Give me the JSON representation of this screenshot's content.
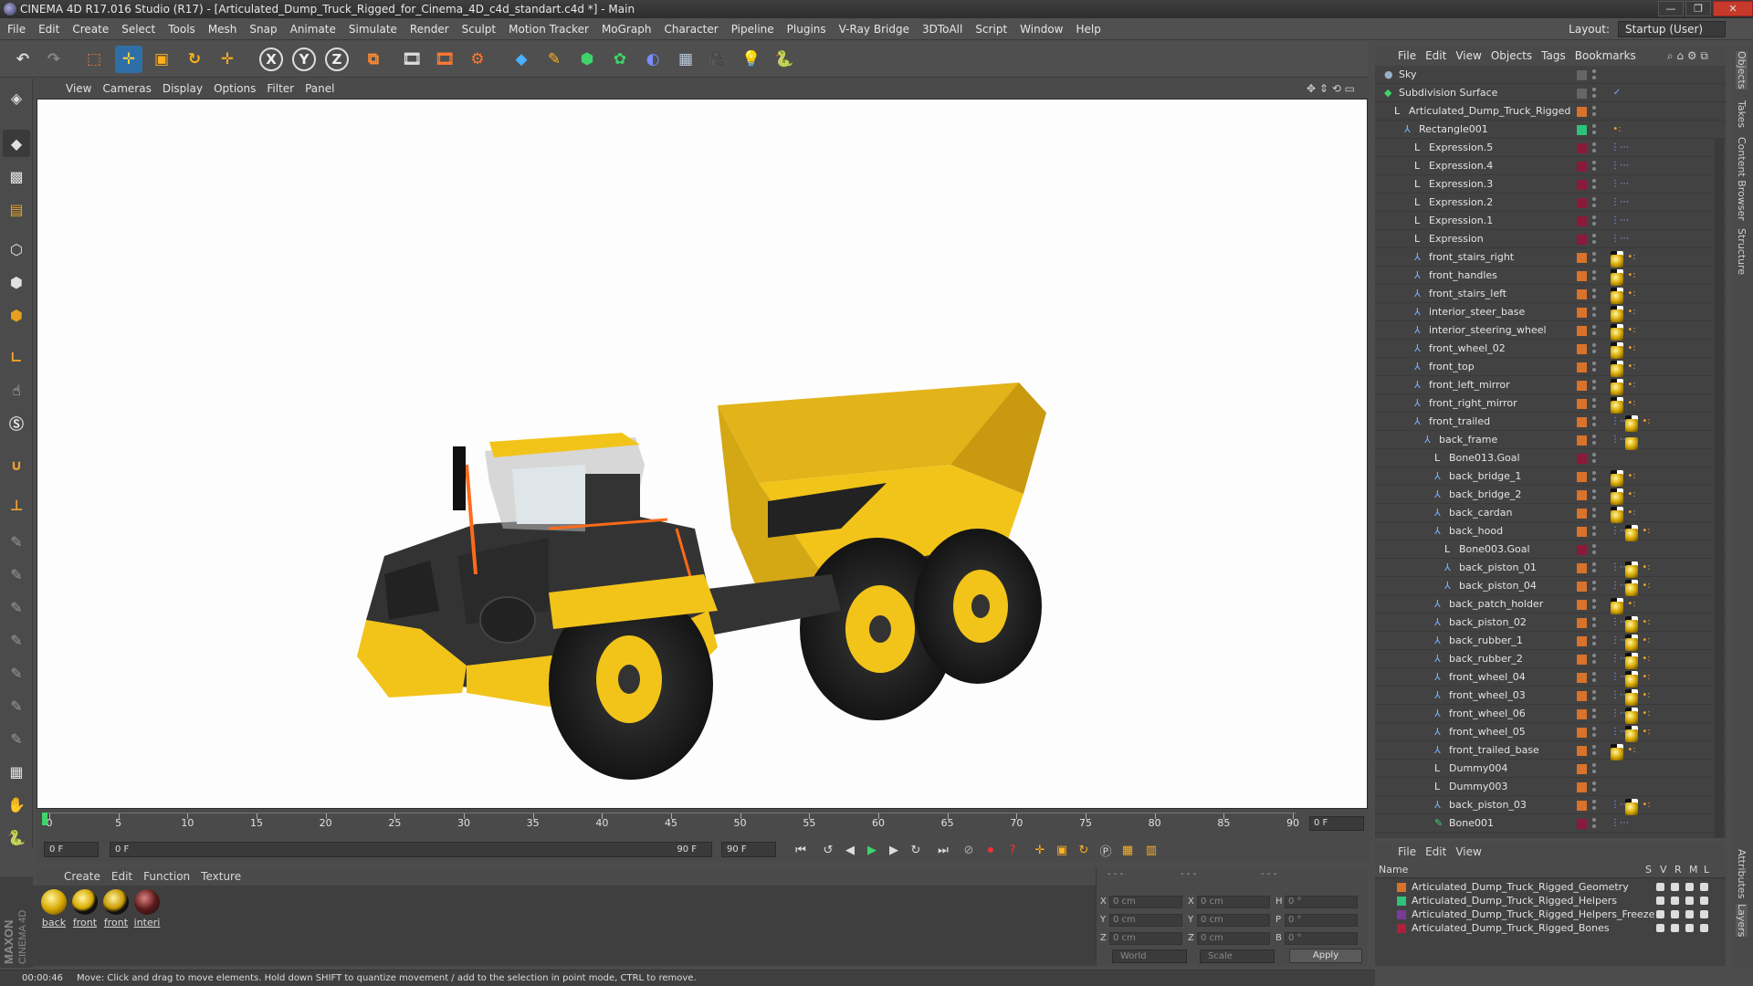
{
  "window": {
    "title": "CINEMA 4D R17.016 Studio (R17) - [Articulated_Dump_Truck_Rigged_for_Cinema_4D_c4d_standart.c4d *] - Main",
    "minimize": "—",
    "maximize": "❐",
    "close": "✕"
  },
  "menubar": {
    "items": [
      "File",
      "Edit",
      "Create",
      "Select",
      "Tools",
      "Mesh",
      "Snap",
      "Animate",
      "Simulate",
      "Render",
      "Sculpt",
      "Motion Tracker",
      "MoGraph",
      "Character",
      "Pipeline",
      "Plugins",
      "V-Ray Bridge",
      "3DToAll",
      "Script",
      "Window",
      "Help"
    ],
    "layout_label": "Layout:",
    "layout_value": "Startup (User)"
  },
  "toolbar": {
    "icons": [
      "undo-icon",
      "redo-icon",
      "live-selection-icon",
      "move-icon",
      "scale-icon",
      "rotate-icon",
      "last-tool-icon",
      "x-axis-icon",
      "y-axis-icon",
      "z-axis-icon",
      "coordinate-system-icon",
      "render-view-icon",
      "render-picture-viewer-icon",
      "edit-render-settings-icon",
      "cube-icon",
      "pen-icon",
      "subdivision-icon",
      "array-icon",
      "deformer-icon",
      "floor-icon",
      "camera-icon",
      "light-icon",
      "python-icon"
    ],
    "axis_x": "X",
    "axis_y": "Y",
    "axis_z": "Z"
  },
  "viewport": {
    "menu": [
      "View",
      "Cameras",
      "Display",
      "Options",
      "Filter",
      "Panel"
    ]
  },
  "timeline": {
    "ticks": [
      "0",
      "5",
      "10",
      "15",
      "20",
      "25",
      "30",
      "35",
      "40",
      "45",
      "50",
      "55",
      "60",
      "65",
      "70",
      "75",
      "80",
      "85",
      "90"
    ],
    "current_frame": "0 F"
  },
  "transport": {
    "start_field": "0 F",
    "range_start": "0 F",
    "range_end": "90 F",
    "end_field": "90 F"
  },
  "material_manager": {
    "menu": [
      "Create",
      "Edit",
      "Function",
      "Texture"
    ],
    "materials": [
      {
        "label": "back",
        "color": "#d8a800"
      },
      {
        "label": "front",
        "color": "#d8a800"
      },
      {
        "label": "front",
        "color": "#c89a00"
      },
      {
        "label": "interi",
        "color": "#5a1a1a"
      }
    ]
  },
  "coordinates": {
    "rows": [
      {
        "axis": "X",
        "pos": "0 cm",
        "axis2": "X",
        "size": "0 cm",
        "rot_axis": "H",
        "rot": "0 °"
      },
      {
        "axis": "Y",
        "pos": "0 cm",
        "axis2": "Y",
        "size": "0 cm",
        "rot_axis": "P",
        "rot": "0 °"
      },
      {
        "axis": "Z",
        "pos": "0 cm",
        "axis2": "Z",
        "size": "0 cm",
        "rot_axis": "B",
        "rot": "0 °"
      }
    ],
    "space": "World",
    "mode": "Scale",
    "apply": "Apply"
  },
  "status": {
    "time": "00:00:46",
    "message": "Move: Click and drag to move elements. Hold down SHIFT to quantize movement / add to the selection in point mode, CTRL to remove."
  },
  "object_manager": {
    "menu": [
      "File",
      "Edit",
      "View",
      "Objects",
      "Tags",
      "Bookmarks"
    ],
    "objects": [
      {
        "name": "Sky",
        "depth": 0,
        "type": "sky",
        "color": "",
        "tags": ""
      },
      {
        "name": "Subdivision Surface",
        "depth": 0,
        "type": "subd",
        "color": "",
        "tags": "check"
      },
      {
        "name": "Articulated_Dump_Truck_Rigged",
        "depth": 1,
        "type": "null",
        "color": "#d9722a",
        "tags": ""
      },
      {
        "name": "Rectangle001",
        "depth": 2,
        "type": "joint",
        "color": "#2ec27a",
        "tags": "dots"
      },
      {
        "name": "Expression.5",
        "depth": 3,
        "type": "null",
        "color": "#8b1a3a",
        "tags": "xp"
      },
      {
        "name": "Expression.4",
        "depth": 3,
        "type": "null",
        "color": "#8b1a3a",
        "tags": "xp"
      },
      {
        "name": "Expression.3",
        "depth": 3,
        "type": "null",
        "color": "#8b1a3a",
        "tags": "xp"
      },
      {
        "name": "Expression.2",
        "depth": 3,
        "type": "null",
        "color": "#8b1a3a",
        "tags": "xp"
      },
      {
        "name": "Expression.1",
        "depth": 3,
        "type": "null",
        "color": "#8b1a3a",
        "tags": "xp"
      },
      {
        "name": "Expression",
        "depth": 3,
        "type": "null",
        "color": "#8b1a3a",
        "tags": "xp"
      },
      {
        "name": "front_stairs_right",
        "depth": 3,
        "type": "joint",
        "color": "#d9722a",
        "tags": "mat"
      },
      {
        "name": "front_handles",
        "depth": 3,
        "type": "joint",
        "color": "#d9722a",
        "tags": "mat"
      },
      {
        "name": "front_stairs_left",
        "depth": 3,
        "type": "joint",
        "color": "#d9722a",
        "tags": "mat"
      },
      {
        "name": "interior_steer_base",
        "depth": 3,
        "type": "joint",
        "color": "#d9722a",
        "tags": "mat"
      },
      {
        "name": "interior_steering_wheel",
        "depth": 3,
        "type": "joint",
        "color": "#d9722a",
        "tags": "mat"
      },
      {
        "name": "front_wheel_02",
        "depth": 3,
        "type": "joint",
        "color": "#d9722a",
        "tags": "mat2"
      },
      {
        "name": "front_top",
        "depth": 3,
        "type": "joint",
        "color": "#d9722a",
        "tags": "mat"
      },
      {
        "name": "front_left_mirror",
        "depth": 3,
        "type": "joint",
        "color": "#d9722a",
        "tags": "mat"
      },
      {
        "name": "front_right_mirror",
        "depth": 3,
        "type": "joint",
        "color": "#d9722a",
        "tags": "mat"
      },
      {
        "name": "front_trailed",
        "depth": 3,
        "type": "joint",
        "color": "#d9722a",
        "tags": "xmat2"
      },
      {
        "name": "back_frame",
        "depth": 4,
        "type": "joint",
        "color": "#d9722a",
        "tags": "xmat"
      },
      {
        "name": "Bone013.Goal",
        "depth": 5,
        "type": "null",
        "color": "#8b1a3a",
        "tags": ""
      },
      {
        "name": "back_bridge_1",
        "depth": 5,
        "type": "joint",
        "color": "#d9722a",
        "tags": "mat"
      },
      {
        "name": "back_bridge_2",
        "depth": 5,
        "type": "joint",
        "color": "#d9722a",
        "tags": "mat"
      },
      {
        "name": "back_cardan",
        "depth": 5,
        "type": "joint",
        "color": "#d9722a",
        "tags": "mat"
      },
      {
        "name": "back_hood",
        "depth": 5,
        "type": "joint",
        "color": "#d9722a",
        "tags": "xmat2"
      },
      {
        "name": "Bone003.Goal",
        "depth": 6,
        "type": "null",
        "color": "#8b1a3a",
        "tags": ""
      },
      {
        "name": "back_piston_01",
        "depth": 6,
        "type": "joint",
        "color": "#d9722a",
        "tags": "xmat2"
      },
      {
        "name": "back_piston_04",
        "depth": 6,
        "type": "joint",
        "color": "#d9722a",
        "tags": "xmat2"
      },
      {
        "name": "back_patch_holder",
        "depth": 5,
        "type": "joint",
        "color": "#d9722a",
        "tags": "mat"
      },
      {
        "name": "back_piston_02",
        "depth": 5,
        "type": "joint",
        "color": "#d9722a",
        "tags": "xmat2"
      },
      {
        "name": "back_rubber_1",
        "depth": 5,
        "type": "joint",
        "color": "#d9722a",
        "tags": "xmat2"
      },
      {
        "name": "back_rubber_2",
        "depth": 5,
        "type": "joint",
        "color": "#d9722a",
        "tags": "xmat2"
      },
      {
        "name": "front_wheel_04",
        "depth": 5,
        "type": "joint",
        "color": "#d9722a",
        "tags": "xmat2"
      },
      {
        "name": "front_wheel_03",
        "depth": 5,
        "type": "joint",
        "color": "#d9722a",
        "tags": "xmat2"
      },
      {
        "name": "front_wheel_06",
        "depth": 5,
        "type": "joint",
        "color": "#d9722a",
        "tags": "xmat2"
      },
      {
        "name": "front_wheel_05",
        "depth": 5,
        "type": "joint",
        "color": "#d9722a",
        "tags": "xmat2"
      },
      {
        "name": "front_trailed_base",
        "depth": 5,
        "type": "joint",
        "color": "#d9722a",
        "tags": "mat"
      },
      {
        "name": "Dummy004",
        "depth": 5,
        "type": "null",
        "color": "#d9722a",
        "tags": ""
      },
      {
        "name": "Dummy003",
        "depth": 5,
        "type": "null",
        "color": "#d9722a",
        "tags": ""
      },
      {
        "name": "back_piston_03",
        "depth": 5,
        "type": "joint",
        "color": "#d9722a",
        "tags": "xmat2"
      },
      {
        "name": "Bone001",
        "depth": 5,
        "type": "bone",
        "color": "#8b1a3a",
        "tags": "xp"
      }
    ]
  },
  "layer_manager": {
    "menu": [
      "File",
      "Edit",
      "View"
    ],
    "header": {
      "name": "Name",
      "cols": [
        "S",
        "V",
        "R",
        "M",
        "L"
      ]
    },
    "layers": [
      {
        "name": "Articulated_Dump_Truck_Rigged_Geometry",
        "color": "#d9722a"
      },
      {
        "name": "Articulated_Dump_Truck_Rigged_Helpers",
        "color": "#2ec27a"
      },
      {
        "name": "Articulated_Dump_Truck_Rigged_Helpers_Freeze",
        "color": "#7a3a9a"
      },
      {
        "name": "Articulated_Dump_Truck_Rigged_Bones",
        "color": "#b0203a"
      }
    ]
  },
  "side_tabs": [
    "Objects",
    "Takes",
    "Content Browser",
    "Structure"
  ],
  "side_tabs_lower": [
    "Attributes",
    "Layers"
  ],
  "colors": {
    "accent": "#2f6fa8",
    "truck_yellow": "#f2c41a"
  }
}
